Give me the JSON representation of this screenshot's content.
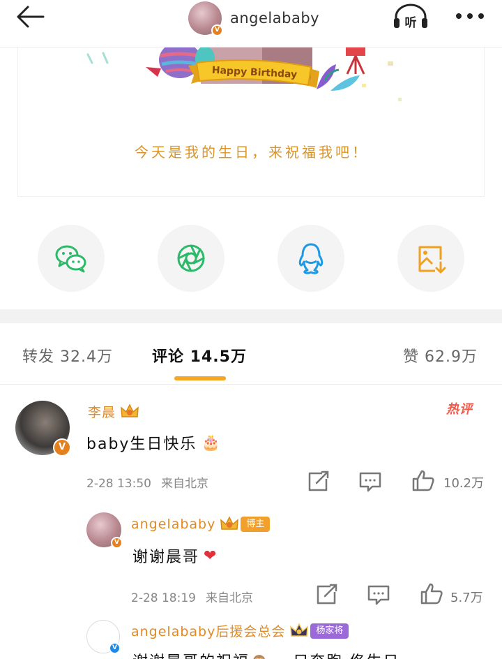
{
  "header": {
    "username": "angelababy",
    "listen_label": "听",
    "verified_badge": "V"
  },
  "card": {
    "banner_text": "Happy Birthday",
    "message": "今天是我的生日，来祝福我吧！"
  },
  "share": {
    "icons": [
      "wechat-icon",
      "moments-icon",
      "qq-icon",
      "save-image-icon"
    ],
    "colors": {
      "wechat": "#2cba6a",
      "moments": "#2cba6a",
      "qq": "#1c9ae6",
      "save": "#f0a11f"
    }
  },
  "tabs": {
    "repost": "转发 32.4万",
    "comments": "评论 14.5万",
    "likes": "赞 62.9万",
    "indicator_color": "#f5a623"
  },
  "comments": [
    {
      "name": "李晨",
      "text": "baby生日快乐",
      "emoji": "🎂",
      "hot_label": "热评",
      "time": "2-28 13:50",
      "location": "来自北京",
      "likes": "10.2万",
      "badge": "V"
    },
    {
      "name": "angelababy",
      "tag": "博主",
      "text": "谢谢晨哥",
      "emoji": "❤",
      "time": "2-28 18:19",
      "location": "来自北京",
      "likes": "5.7万",
      "badge": "V"
    },
    {
      "name": "angelababy后援会总会",
      "tag": "杨家将",
      "text": "谢谢晨哥的祝福🙈 一只奔跑 佟生日",
      "badge": "V"
    }
  ],
  "colors": {
    "accent_orange": "#e38a22",
    "hot_red": "#f15a4a",
    "verified_orange": "#e5801e",
    "verified_blue": "#1f8ae6"
  }
}
